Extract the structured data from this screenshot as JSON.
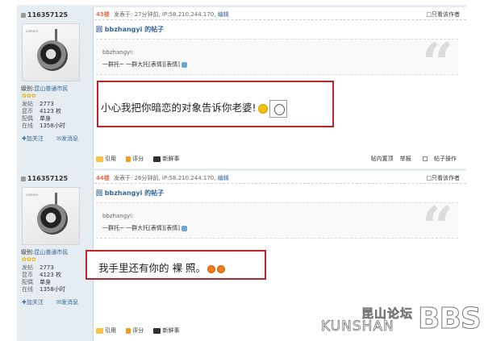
{
  "posts": [
    {
      "author": "116357125",
      "rank_label": "级别:",
      "rank_value": "昆山普通市民",
      "stars": "✿✿✿",
      "stats": [
        {
          "k": "发帖",
          "v": "2773"
        },
        {
          "k": "昆币",
          "v": "4123 枚"
        },
        {
          "k": "配偶",
          "v": "单身"
        },
        {
          "k": "在线",
          "v": "1358小时"
        }
      ],
      "follow_label": "加关注",
      "message_label": "发消息",
      "floor": "43楼",
      "posted": "发表于: 27分钟前",
      "ip": ", IP:58.210.244.170",
      "edit": ", 编辑",
      "only_author": "只看该作者",
      "title": "回 bbzhangyi 的帖子",
      "quote_name": "bbzhangyi:",
      "quote_text": "一群托~ 一群大托[表情][表情]",
      "content": "小心我把你暗恋的对象告诉你老婆!",
      "act_quote": "引用",
      "act_rate": "评分",
      "act_trade": "新鲜事",
      "right_links": [
        "帖内置顶",
        "举报",
        "帖子操作"
      ]
    },
    {
      "author": "116357125",
      "rank_label": "级别:",
      "rank_value": "昆山普通市民",
      "stars": "✿✿✿",
      "stats": [
        {
          "k": "发帖",
          "v": "2773"
        },
        {
          "k": "昆币",
          "v": "4123 枚"
        },
        {
          "k": "配偶",
          "v": "单身"
        },
        {
          "k": "在线",
          "v": "1358小时"
        }
      ],
      "follow_label": "加关注",
      "message_label": "发消息",
      "floor": "44楼",
      "posted": "发表于: 26分钟前",
      "ip": ", IP:58.210.244.170",
      "edit": ", 编辑",
      "only_author": "只看该作者",
      "title": "回 bbzhangyi 的帖子",
      "quote_name": "bbzhangyi:",
      "quote_text": "一群托~ 一群大托[表情][表情]",
      "content": "我手里还有你的 裸 照。",
      "act_quote": "引用",
      "act_rate": "评分",
      "act_trade": "新鲜事"
    }
  ],
  "watermark": {
    "cn": "昆山论坛",
    "en": "KUNSHAN",
    "bbs": "BBS"
  }
}
